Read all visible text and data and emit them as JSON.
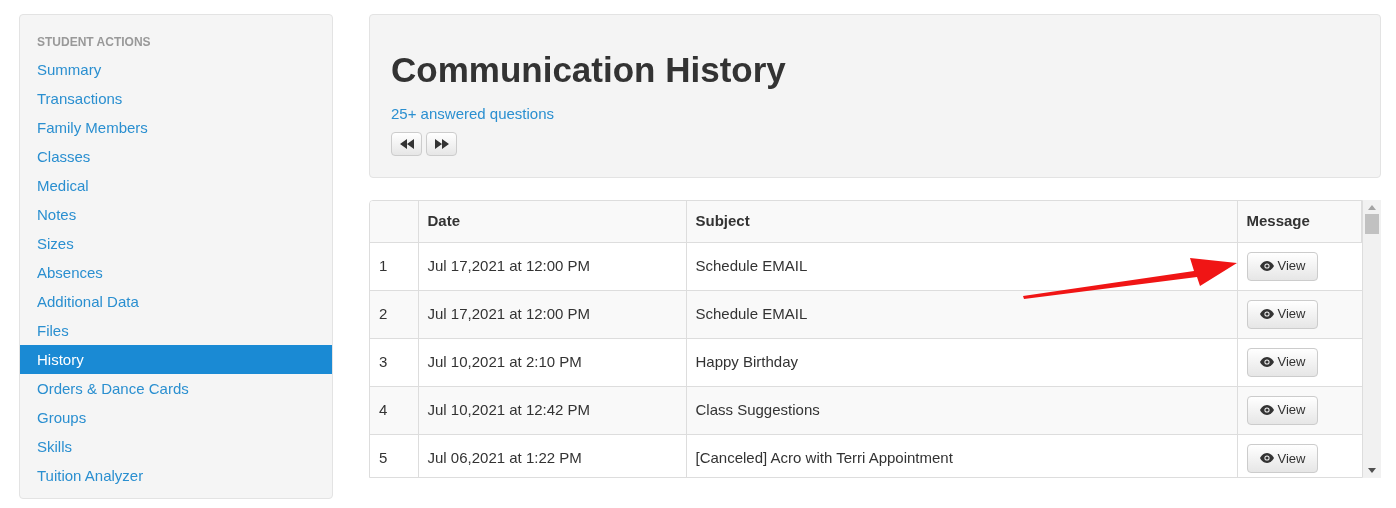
{
  "sidebar": {
    "heading": "STUDENT ACTIONS",
    "items": [
      {
        "label": "Summary",
        "selected": false
      },
      {
        "label": "Transactions",
        "selected": false
      },
      {
        "label": "Family Members",
        "selected": false
      },
      {
        "label": "Classes",
        "selected": false
      },
      {
        "label": "Medical",
        "selected": false
      },
      {
        "label": "Notes",
        "selected": false
      },
      {
        "label": "Sizes",
        "selected": false
      },
      {
        "label": "Absences",
        "selected": false
      },
      {
        "label": "Additional Data",
        "selected": false
      },
      {
        "label": "Files",
        "selected": false
      },
      {
        "label": "History",
        "selected": true
      },
      {
        "label": "Orders & Dance Cards",
        "selected": false
      },
      {
        "label": "Groups",
        "selected": false
      },
      {
        "label": "Skills",
        "selected": false
      },
      {
        "label": "Tuition Analyzer",
        "selected": false
      }
    ]
  },
  "header": {
    "title": "Communication History",
    "link": "25+ answered questions"
  },
  "table": {
    "columns": [
      "Date",
      "Subject",
      "Message"
    ],
    "rows": [
      {
        "number": "1",
        "date": "Jul 17,2021 at 12:00 PM",
        "subject": "Schedule EMAIL",
        "action": "View"
      },
      {
        "number": "2",
        "date": "Jul 17,2021 at 12:00 PM",
        "subject": "Schedule EMAIL",
        "action": "View"
      },
      {
        "number": "3",
        "date": "Jul 10,2021 at 2:10 PM",
        "subject": "Happy Birthday",
        "action": "View"
      },
      {
        "number": "4",
        "date": "Jul 10,2021 at 12:42 PM",
        "subject": "Class Suggestions",
        "action": "View"
      },
      {
        "number": "5",
        "date": "Jul 06,2021 at 1:22 PM",
        "subject": "[Canceled] Acro with Terri Appointment",
        "action": "View"
      }
    ]
  }
}
